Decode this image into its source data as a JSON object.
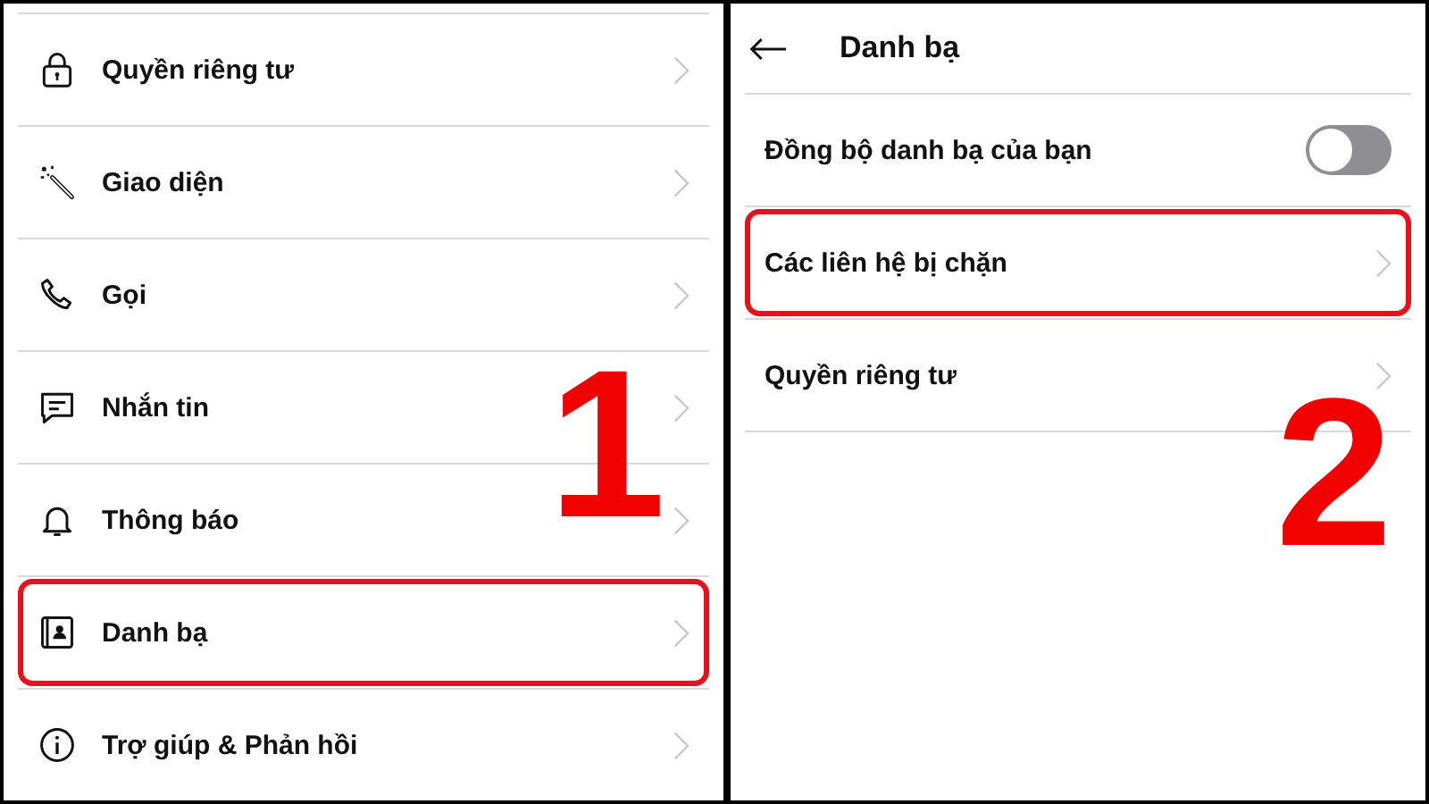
{
  "left_screen": {
    "step": "1",
    "items": [
      {
        "label": "Quyền riêng tư",
        "highlighted": false
      },
      {
        "label": "Giao diện",
        "highlighted": false
      },
      {
        "label": "Gọi",
        "highlighted": false
      },
      {
        "label": "Nhắn tin",
        "highlighted": false
      },
      {
        "label": "Thông báo",
        "highlighted": false
      },
      {
        "label": "Danh bạ",
        "highlighted": true
      },
      {
        "label": "Trợ giúp & Phản hồi",
        "highlighted": false
      }
    ]
  },
  "right_screen": {
    "step": "2",
    "title": "Danh bạ",
    "items": [
      {
        "kind": "toggle",
        "label": "Đồng bộ danh bạ của bạn",
        "on": false,
        "highlighted": false
      },
      {
        "kind": "link",
        "label": "Các liên hệ bị chặn",
        "highlighted": true
      },
      {
        "kind": "link",
        "label": "Quyền riêng tư",
        "highlighted": false
      }
    ]
  }
}
